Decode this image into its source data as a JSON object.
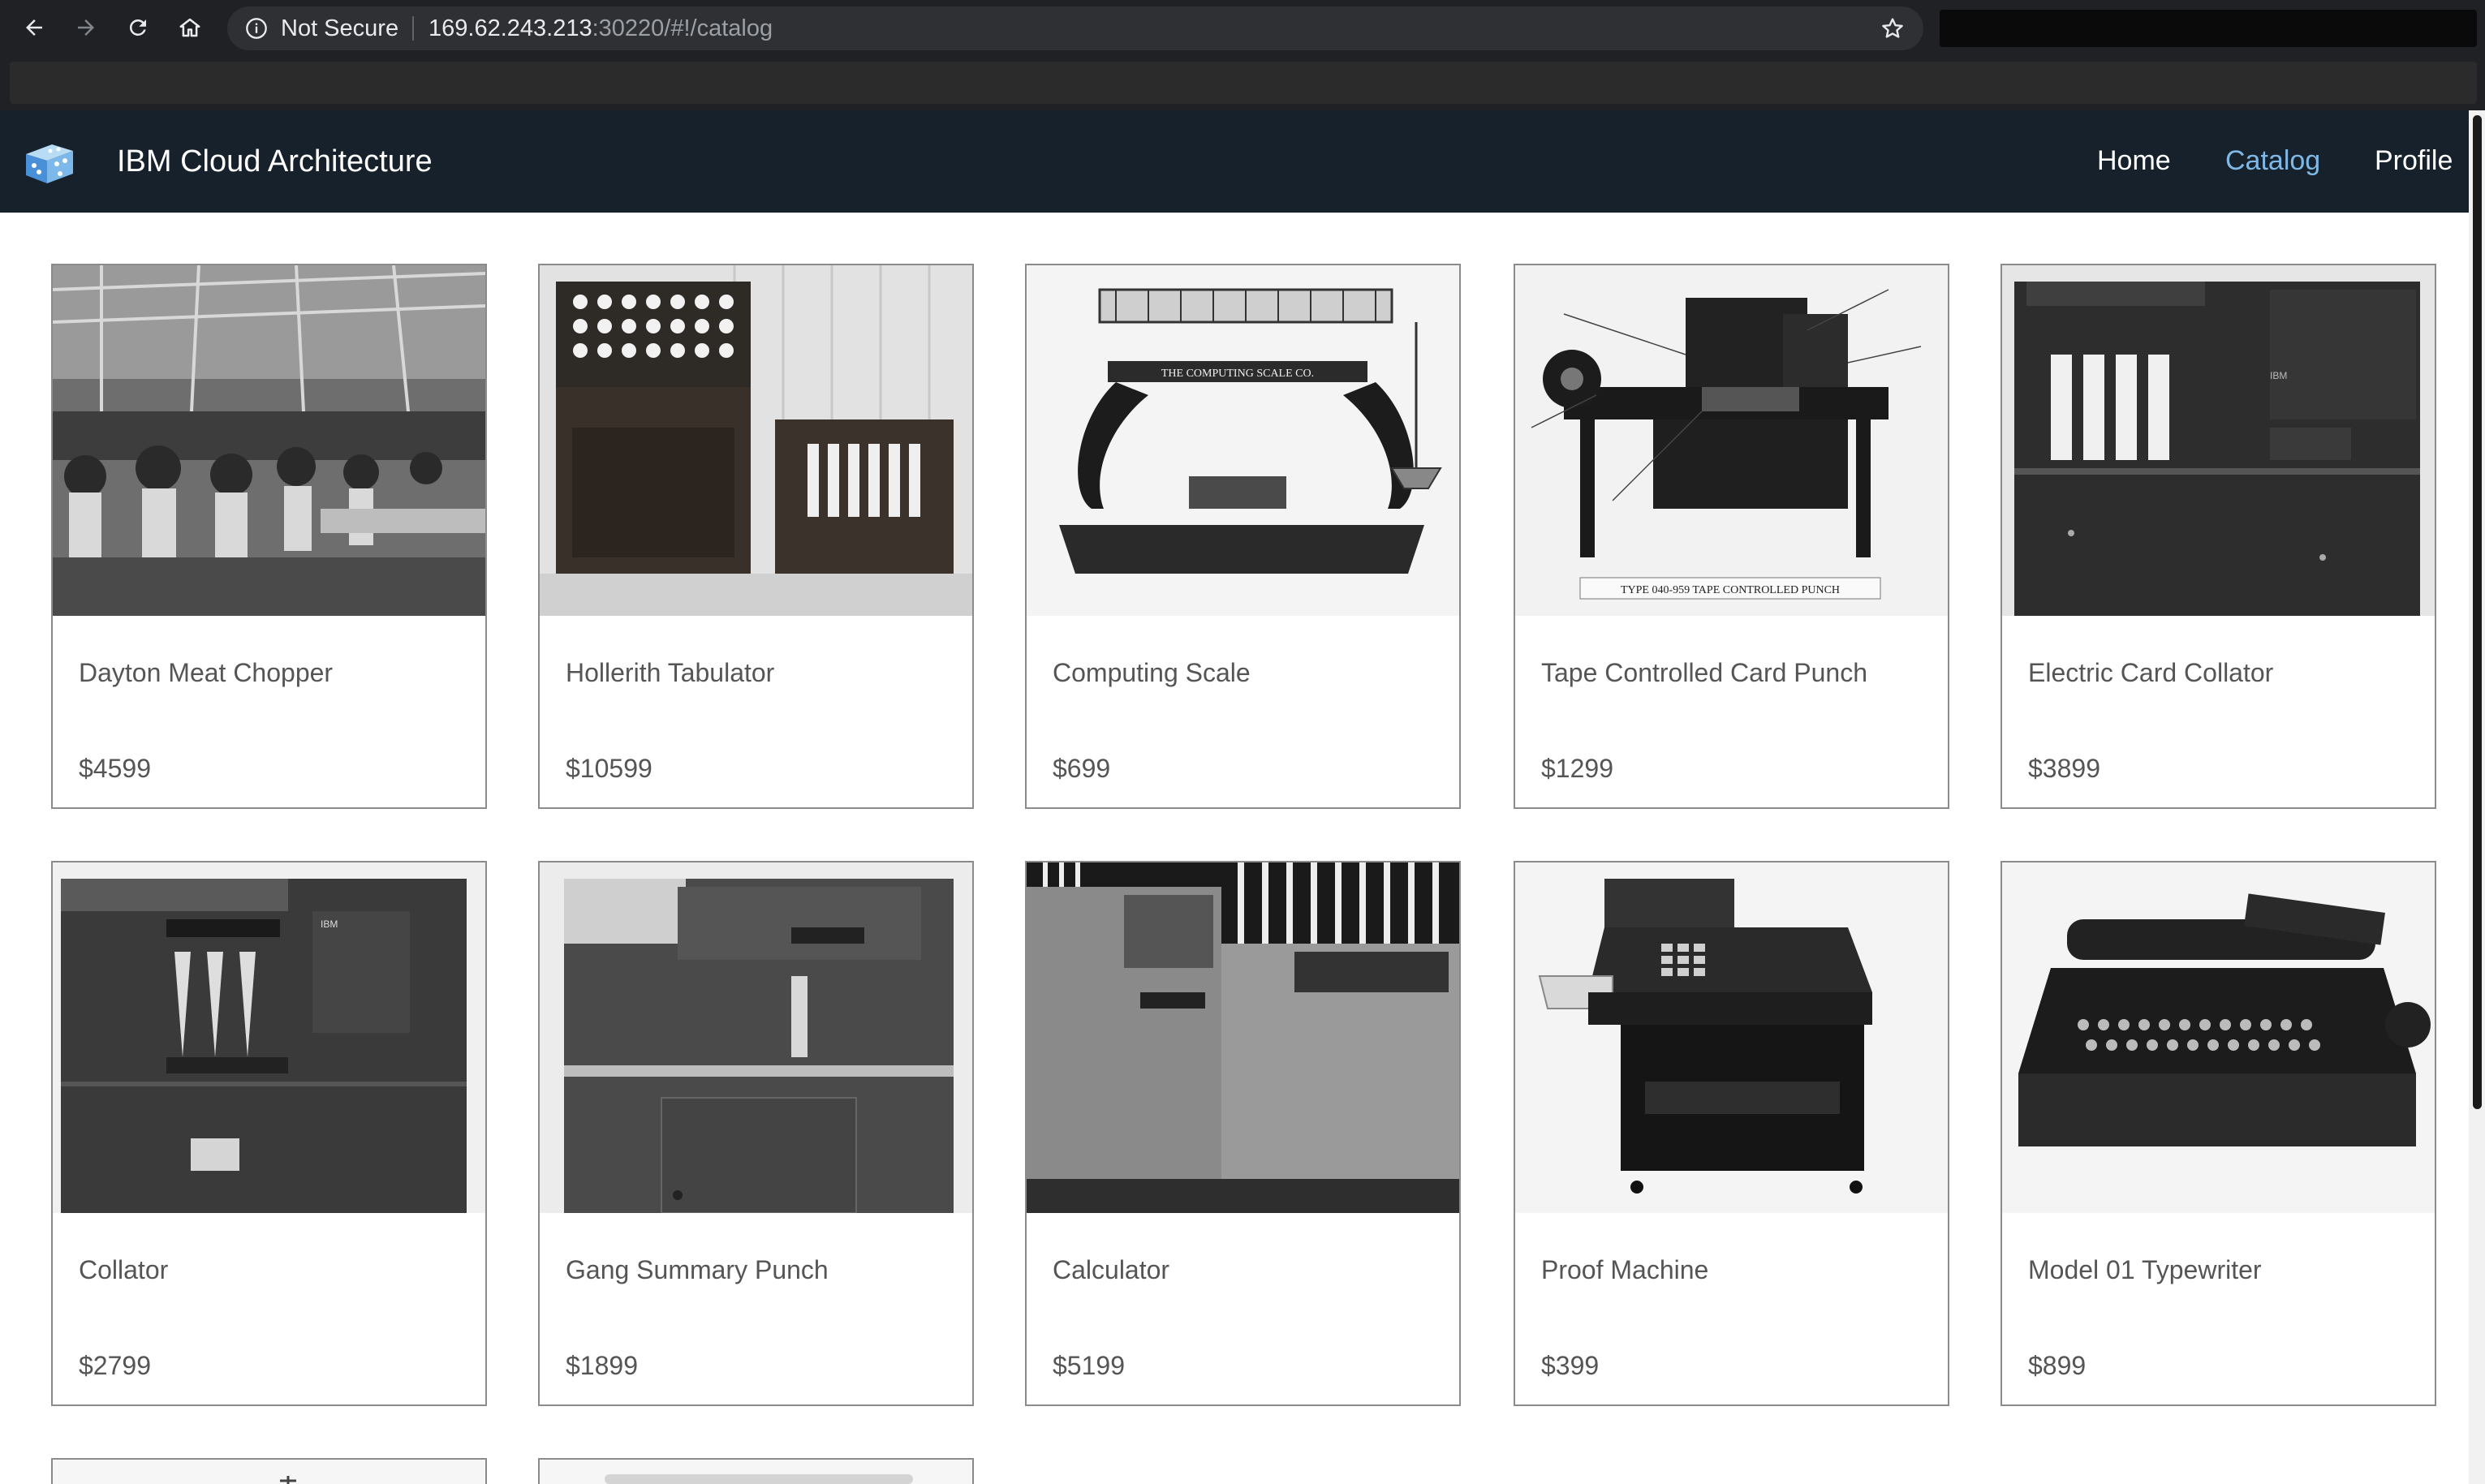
{
  "browser": {
    "security_label": "Not Secure",
    "url_host": "169.62.243.213",
    "url_rest": ":30220/#!/catalog",
    "icons": [
      "back-arrow-icon",
      "forward-arrow-icon",
      "reload-icon",
      "home-icon",
      "info-icon",
      "bookmark-star-icon"
    ]
  },
  "app": {
    "brand": "IBM Cloud Architecture",
    "nav": {
      "home": "Home",
      "catalog": "Catalog",
      "profile": "Profile"
    },
    "active_nav": "Catalog",
    "colors": {
      "navbar": "#16212b",
      "active_link": "#7fb8e6",
      "text": "#555555"
    }
  },
  "catalog": {
    "items": [
      {
        "name": "Dayton Meat Chopper",
        "price": "$4599"
      },
      {
        "name": "Hollerith Tabulator",
        "price": "$10599"
      },
      {
        "name": "Computing Scale",
        "price": "$699"
      },
      {
        "name": "Tape Controlled Card Punch",
        "price": "$1299"
      },
      {
        "name": "Electric Card Collator",
        "price": "$3899"
      },
      {
        "name": "Collator",
        "price": "$2799"
      },
      {
        "name": "Gang Summary Punch",
        "price": "$1899"
      },
      {
        "name": "Calculator",
        "price": "$5199"
      },
      {
        "name": "Proof Machine",
        "price": "$399"
      },
      {
        "name": "Model 01 Typewriter",
        "price": "$899"
      }
    ],
    "photo_labels": {
      "computing_scale": "THE COMPUTING SCALE CO.",
      "tape_punch": "TYPE 040-959 TAPE CONTROLLED PUNCH",
      "ibm": "IBM"
    }
  }
}
